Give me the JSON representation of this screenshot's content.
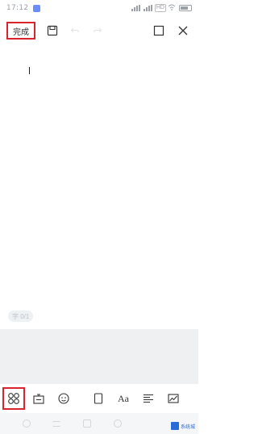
{
  "status_bar": {
    "time": "17:12",
    "network_label": "HD"
  },
  "toolbar": {
    "finish_label": "完成"
  },
  "editor": {
    "hint_text": "字 0/1"
  },
  "format_bar": {
    "font_label": "Aa"
  },
  "watermark": {
    "text": "系统城"
  },
  "colors": {
    "highlight": "#d9232d",
    "icon": "#333333",
    "gray_area": "#eef0f2"
  }
}
